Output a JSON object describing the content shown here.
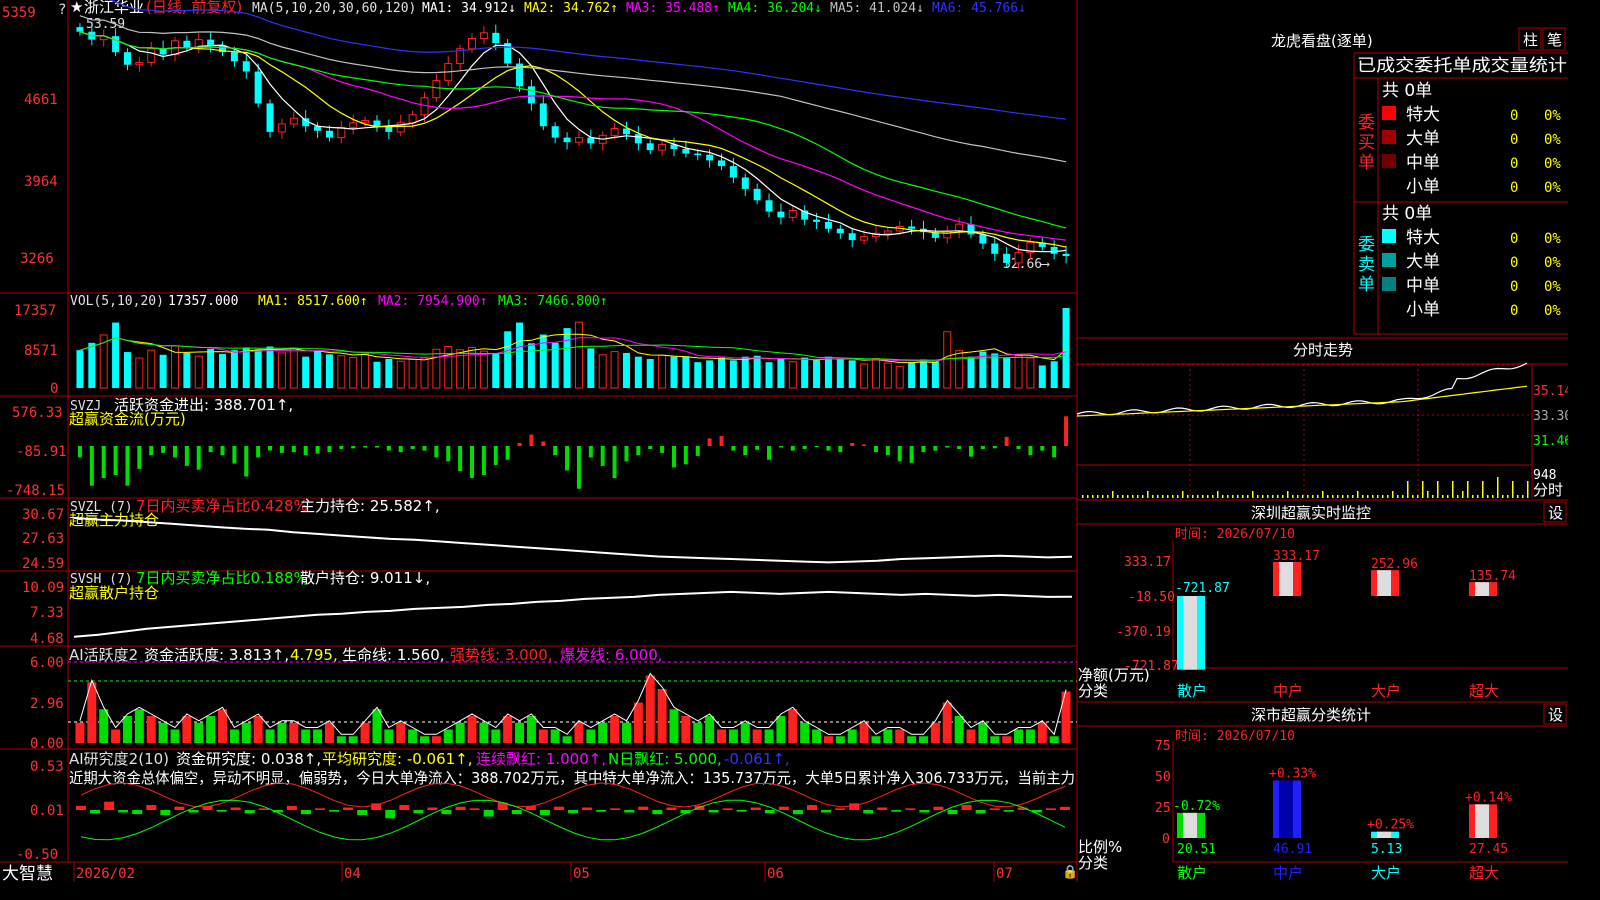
{
  "stock": {
    "name": "浙江华业",
    "mode": "(日线, 前复权)",
    "star": "★"
  },
  "colors": {
    "up": "#ff2020",
    "down": "#00ffff",
    "ma1": "#ffffff",
    "ma2": "#ffff00",
    "ma3": "#ff00ff",
    "ma4": "#00ff00",
    "ma5": "#c0c0c0",
    "ma6": "#3030ff",
    "grid": "#aa0000",
    "axis_text": "#ff3030"
  },
  "main_pane": {
    "legend_label": "MA(5,10,20,30,60,120)",
    "legend": [
      {
        "name": "MA1:",
        "value": "34.912",
        "arrow": "↓",
        "color": "#ffffff"
      },
      {
        "name": "MA2:",
        "value": "34.762",
        "arrow": "↑",
        "color": "#ffff00"
      },
      {
        "name": "MA3:",
        "value": "35.488",
        "arrow": "↑",
        "color": "#ff00ff"
      },
      {
        "name": "MA4:",
        "value": "36.204",
        "arrow": "↓",
        "color": "#00ff00"
      },
      {
        "name": "MA5:",
        "value": "41.024",
        "arrow": "↓",
        "color": "#c0c0c0"
      },
      {
        "name": "MA6:",
        "value": "45.766",
        "arrow": "↓",
        "color": "#3030ff"
      }
    ],
    "y_ticks": [
      "5359",
      "4661",
      "3964",
      "3266"
    ],
    "high_label": "53.59",
    "low_label": "32.66"
  },
  "vol_pane": {
    "legend_label": "VOL(5,10,20)",
    "value": "17357.000",
    "legend": [
      {
        "name": "MA1:",
        "value": "8517.600",
        "arrow": "↑",
        "color": "#ffff00"
      },
      {
        "name": "MA2:",
        "value": "7954.900",
        "arrow": "↑",
        "color": "#ff00ff"
      },
      {
        "name": "MA3:",
        "value": "7466.800",
        "arrow": "↑",
        "color": "#00ff00"
      }
    ],
    "y_ticks": [
      "17357",
      "8571",
      "0"
    ]
  },
  "svzj_pane": {
    "label": "SVZJ",
    "line1": "活跃资金进出: 388.701↑,",
    "line2": "超赢资金流(万元)",
    "y_ticks": [
      "576.33",
      "-85.91",
      "-748.15"
    ]
  },
  "svzl_pane": {
    "label": "SVZL (7)",
    "text_red": "7日内买卖净占比0.428%",
    "text_white": "主力持仓: 25.582↑,",
    "line2": "超赢主力持仓",
    "y_ticks": [
      "30.67",
      "27.63",
      "24.59"
    ]
  },
  "svsh_pane": {
    "label": "SVSH (7)",
    "text_green": "7日内买卖净占比0.188%",
    "text_white": "散户持仓: 9.011↓,",
    "line2": "超赢散户持仓",
    "y_ticks": [
      "10.09",
      "7.33",
      "4.68"
    ]
  },
  "ai_huoyue": {
    "label": "AI活跃度2",
    "t1": "资金活跃度: 3.813↑,",
    "t2": "4.795,",
    "t3": "生命线: 1.560,",
    "t4": "强势线: 3.000,",
    "t5": "爆发线: 6.000,",
    "y_ticks": [
      "6.00",
      "2.96",
      "0.00"
    ]
  },
  "ai_yanjiu": {
    "label": "AI研究度2(10)",
    "t1": "资金研究度: 0.038↑,",
    "t2": "平均研究度: -0.061↑,",
    "t3": "连续飘红: 1.000↑,",
    "t4": "N日飘红: 5.000,",
    "t5": "-0.061↑,",
    "desc": "近期大资金总体偏空，异动不明显，偏弱势，今日大单净流入：388.702万元，其中特大单净流入：135.737万元，大单5日累计净入306.733万元，当前主力",
    "y_ticks": [
      "0.53",
      "0.01",
      "-0.50"
    ]
  },
  "x_axis": {
    "brand": "大智慧",
    "labels": [
      "2026/02",
      "04",
      "05",
      "06",
      "07"
    ]
  },
  "longhu": {
    "title": "龙虎看盘(逐单)",
    "btn1": "柱",
    "btn2": "笔",
    "subtitle": "已成交委托单成交量统计",
    "buy_side": "委买单",
    "sell_side": "委卖单",
    "buy_total": "共 0单",
    "sell_total": "共 0单",
    "buy_rows": [
      {
        "label": "特大",
        "count": "0",
        "pct": "0%",
        "color": "#ff0000"
      },
      {
        "label": "大单",
        "count": "0",
        "pct": "0%",
        "color": "#a00000"
      },
      {
        "label": "中单",
        "count": "0",
        "pct": "0%",
        "color": "#700000"
      },
      {
        "label": "小单",
        "count": "0",
        "pct": "0%",
        "color": ""
      }
    ],
    "sell_rows": [
      {
        "label": "特大",
        "count": "0",
        "pct": "0%",
        "color": "#00ffff"
      },
      {
        "label": "大单",
        "count": "0",
        "pct": "0%",
        "color": "#00a0a0"
      },
      {
        "label": "中单",
        "count": "0",
        "pct": "0%",
        "color": "#008080"
      },
      {
        "label": "小单",
        "count": "0",
        "pct": "0%",
        "color": ""
      }
    ]
  },
  "intraday": {
    "title": "分时走势",
    "y_ticks": [
      "35.14",
      "33.30",
      "31.46"
    ],
    "vol_label": "948",
    "vol_unit": "分时"
  },
  "sz_monitor": {
    "title": "深圳超赢实时监控",
    "btn": "设",
    "time": "时间: 2026/07/10",
    "y_ticks": [
      "333.17",
      "-18.50",
      "-370.19",
      "-721.87"
    ],
    "unit_line1": "净额(万元)",
    "unit_line2": "分类",
    "categories": [
      "散户",
      "中户",
      "大户",
      "超大"
    ],
    "values": [
      -721.87,
      333.17,
      252.96,
      135.74
    ],
    "labels": [
      "-721.87",
      "333.17",
      "252.96",
      "135.74"
    ]
  },
  "sz_class": {
    "title": "深市超赢分类统计",
    "btn": "设",
    "time": "时间: 2026/07/10",
    "y_ticks": [
      "75",
      "50",
      "25",
      "0"
    ],
    "unit_line1": "比例%",
    "unit_line2": "分类",
    "categories": [
      "散户",
      "中户",
      "大户",
      "超大"
    ],
    "values": [
      20.51,
      46.91,
      5.13,
      27.45
    ],
    "value_labels": [
      "20.51",
      "46.91",
      "5.13",
      "27.45"
    ],
    "change_labels": [
      "-0.72%",
      "+0.33%",
      "+0.25%",
      "+0.14%"
    ]
  },
  "chart_data": [
    {
      "type": "candlestick",
      "title": "浙江华业 (日线, 前复权)",
      "y_ticks": [
        "5359",
        "4661",
        "3964",
        "3266"
      ],
      "x_labels": [
        "2026/02",
        "04",
        "05",
        "06",
        "07"
      ],
      "annotations": [
        "53.59",
        "32.66"
      ],
      "close": [
        53.3,
        52.6,
        52.9,
        51.5,
        50.4,
        50.6,
        51.8,
        51.3,
        52.5,
        51.9,
        52.6,
        52.1,
        51.5,
        50.7,
        49.8,
        47.0,
        44.5,
        45.2,
        45.7,
        45.0,
        44.6,
        44.0,
        44.9,
        45.3,
        45.5,
        45.0,
        44.5,
        45.3,
        46.0,
        47.5,
        49.0,
        50.5,
        51.8,
        52.7,
        53.2,
        52.3,
        50.5,
        48.5,
        47.0,
        45.0,
        44.0,
        43.6,
        44.0,
        43.5,
        44.2,
        44.8,
        44.3,
        43.5,
        42.9,
        43.4,
        43.0,
        42.6,
        42.5,
        42.0,
        41.5,
        40.5,
        39.5,
        38.5,
        37.5,
        37.0,
        37.6,
        36.8,
        36.6,
        36.0,
        35.6,
        35.0,
        35.3,
        35.6,
        35.8,
        36.2,
        36.0,
        35.7,
        35.2,
        35.8,
        36.4,
        35.5,
        34.7,
        33.8,
        33.0,
        33.9,
        34.8,
        34.4,
        33.8,
        33.6
      ],
      "series": [
        {
          "name": "MA1",
          "values": [
            34.912
          ]
        },
        {
          "name": "MA2",
          "values": [
            34.762
          ]
        },
        {
          "name": "MA3",
          "values": [
            35.488
          ]
        },
        {
          "name": "MA4",
          "values": [
            36.204
          ]
        },
        {
          "name": "MA5",
          "values": [
            41.024
          ]
        },
        {
          "name": "MA6",
          "values": [
            45.766
          ]
        }
      ]
    },
    {
      "type": "bar",
      "title": "VOL(5,10,20)",
      "y_ticks": [
        "17357",
        "8571",
        "0"
      ],
      "values": [
        8200,
        9800,
        11500,
        14200,
        7800,
        6500,
        8200,
        7200,
        9100,
        7600,
        6900,
        8500,
        7400,
        8200,
        8800,
        8400,
        9000,
        7600,
        8700,
        6800,
        8100,
        7300,
        7000,
        6600,
        7400,
        5700,
        6300,
        5800,
        6200,
        6500,
        8400,
        9000,
        8300,
        8800,
        8000,
        7600,
        12300,
        14200,
        9700,
        11600,
        9800,
        13000,
        14300,
        8600,
        7200,
        7900,
        7600,
        6800,
        6300,
        7100,
        6800,
        6900,
        5600,
        6000,
        6600,
        6000,
        6800,
        7000,
        5600,
        6500,
        5700,
        6600,
        6000,
        6800,
        6200,
        6000,
        5200,
        6400,
        5400,
        4700,
        5600,
        6200,
        5700,
        12200,
        8100,
        6800,
        7900,
        7500,
        6600,
        7000,
        6500,
        4900,
        5800,
        17357
      ],
      "series": [
        {
          "name": "MA1",
          "values": [
            8517.6
          ]
        },
        {
          "name": "MA2",
          "values": [
            7954.9
          ]
        },
        {
          "name": "MA3",
          "values": [
            7466.8
          ]
        }
      ]
    },
    {
      "type": "bar",
      "title": "SVZJ 超赢资金流(万元)",
      "y_ticks": [
        "576.33",
        "-85.91",
        "-748.15"
      ],
      "values": [
        -150,
        -520,
        -420,
        -380,
        -520,
        -300,
        -120,
        -90,
        -150,
        -260,
        -310,
        -80,
        -120,
        -230,
        -400,
        -150,
        -60,
        -90,
        -80,
        -120,
        -100,
        -80,
        -40,
        -30,
        -20,
        -20,
        -60,
        -80,
        -40,
        -60,
        -150,
        -200,
        -330,
        -420,
        -380,
        -250,
        -180,
        40,
        150,
        60,
        -120,
        -320,
        -560,
        -150,
        -260,
        -420,
        -200,
        -120,
        -40,
        -90,
        -280,
        -240,
        -130,
        100,
        130,
        -60,
        -120,
        -50,
        -180,
        -20,
        -60,
        -40,
        -10,
        -60,
        -80,
        40,
        20,
        -80,
        -120,
        -200,
        -220,
        -80,
        -60,
        -20,
        -40,
        -140,
        -40,
        -30,
        120,
        -40,
        -120,
        -60,
        -150,
        388.7
      ]
    },
    {
      "type": "line",
      "title": "SVZL (7) 超赢主力持仓",
      "y_ticks": [
        "30.67",
        "27.63",
        "24.59"
      ],
      "series": [
        {
          "name": "主力持仓",
          "values": [
            30.2,
            30.0,
            29.9,
            29.7,
            29.5,
            29.3,
            29.1,
            28.9,
            28.8,
            28.5,
            28.3,
            28.1,
            27.9,
            27.7,
            27.6,
            27.4,
            27.2,
            27.0,
            26.8,
            26.6,
            26.4,
            26.2,
            26.0,
            25.8,
            25.6,
            25.5,
            25.4,
            25.3,
            25.2,
            25.1,
            25.0,
            24.9,
            25.0,
            25.1,
            25.3,
            25.4,
            25.5,
            25.6,
            25.7,
            25.6,
            25.5,
            25.582
          ]
        }
      ]
    },
    {
      "type": "line",
      "title": "SVSH (7) 超赢散户持仓",
      "y_ticks": [
        "10.09",
        "7.33",
        "4.68"
      ],
      "series": [
        {
          "name": "散户持仓",
          "values": [
            5.0,
            5.2,
            5.5,
            5.8,
            6.0,
            6.2,
            6.4,
            6.6,
            6.8,
            7.0,
            7.2,
            7.3,
            7.5,
            7.6,
            7.8,
            7.9,
            8.0,
            8.2,
            8.3,
            8.5,
            8.6,
            8.8,
            8.9,
            9.0,
            9.2,
            9.3,
            9.4,
            9.5,
            9.4,
            9.3,
            9.4,
            9.5,
            9.4,
            9.3,
            9.2,
            9.3,
            9.2,
            9.1,
            9.2,
            9.1,
            9.0,
            9.011
          ]
        }
      ]
    },
    {
      "type": "bar",
      "title": "AI活跃度2",
      "y_ticks": [
        "6.00",
        "2.96",
        "0.00"
      ],
      "values": [
        1.5,
        4.5,
        2.5,
        1.0,
        2.0,
        2.5,
        2.0,
        1.5,
        1.0,
        2.0,
        1.5,
        2.0,
        2.5,
        1.0,
        1.5,
        2.0,
        1.0,
        1.5,
        1.5,
        1.0,
        1.0,
        1.5,
        0.5,
        0.5,
        1.5,
        2.5,
        1.0,
        1.5,
        1.0,
        0.5,
        0.5,
        1.0,
        1.5,
        2.0,
        1.5,
        1.0,
        2.0,
        1.5,
        2.0,
        1.0,
        1.0,
        0.5,
        1.5,
        1.0,
        1.5,
        2.0,
        1.5,
        3.0,
        5.0,
        4.0,
        2.5,
        2.0,
        1.5,
        2.0,
        1.0,
        1.0,
        1.5,
        1.0,
        1.0,
        2.0,
        2.5,
        1.5,
        1.0,
        0.5,
        0.5,
        1.0,
        1.5,
        0.5,
        1.0,
        1.0,
        0.5,
        0.5,
        1.5,
        3.0,
        2.0,
        1.0,
        1.5,
        0.5,
        0.5,
        1.0,
        1.0,
        1.5,
        0.5,
        3.813
      ]
    },
    {
      "type": "bar",
      "title": "AI研究度2(10)",
      "y_ticks": [
        "0.53",
        "0.01",
        "-0.50"
      ],
      "values": [
        0.05,
        -0.04,
        0.1,
        -0.03,
        -0.05,
        0.06,
        -0.06,
        0.04,
        -0.03,
        0.05,
        -0.02,
        0.03,
        -0.04,
        0.02,
        -0.03,
        0.05,
        -0.05,
        0.02,
        -0.02,
        0.03,
        -0.06,
        0.08,
        -0.1,
        0.06,
        -0.04,
        0.03,
        -0.05,
        0.04,
        0.02,
        -0.08,
        0.09,
        -0.05,
        0.05,
        -0.06,
        0.04,
        -0.04,
        0.03,
        -0.02,
        0.02,
        -0.03,
        0.04,
        -0.05,
        0.03,
        -0.04,
        0.05,
        -0.03,
        0.02,
        -0.02,
        0.03,
        -0.04,
        0.04,
        -0.05,
        0.06,
        -0.03,
        0.02,
        0.08,
        -0.04,
        0.03,
        -0.02,
        0.02,
        -0.03,
        0.04,
        -0.05,
        0.06,
        -0.04,
        0.02,
        -0.02,
        0.03,
        -0.03,
        0.02,
        0.038
      ],
      "series": [
        {
          "name": "资金研究度",
          "values": [
            0.038
          ]
        },
        {
          "name": "平均研究度",
          "values": [
            -0.061
          ]
        }
      ]
    },
    {
      "type": "bar",
      "title": "深圳超赢实时监控",
      "categories": [
        "散户",
        "中户",
        "大户",
        "超大"
      ],
      "values": [
        -721.87,
        333.17,
        252.96,
        135.74
      ],
      "ylabel": "净额(万元)",
      "y_ticks": [
        "333.17",
        "-18.50",
        "-370.19",
        "-721.87"
      ]
    },
    {
      "type": "bar",
      "title": "深市超赢分类统计",
      "categories": [
        "散户",
        "中户",
        "大户",
        "超大"
      ],
      "values": [
        20.51,
        46.91,
        5.13,
        27.45
      ],
      "ylabel": "比例%",
      "y_ticks": [
        "75",
        "50",
        "25",
        "0"
      ]
    }
  ]
}
